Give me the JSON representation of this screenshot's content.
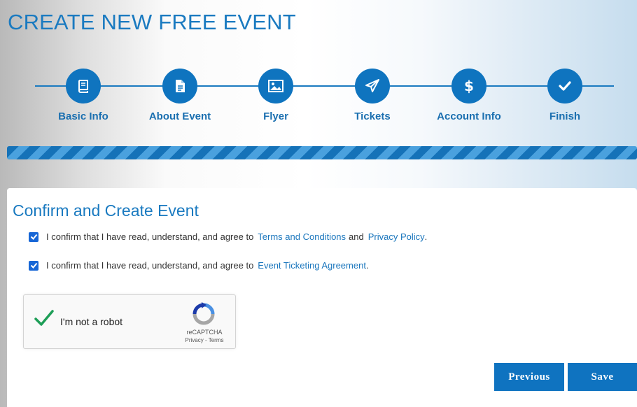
{
  "page": {
    "title": "CREATE NEW FREE EVENT"
  },
  "steps": [
    {
      "label": "Basic Info",
      "icon": "book-icon"
    },
    {
      "label": "About Event",
      "icon": "document-icon"
    },
    {
      "label": "Flyer",
      "icon": "image-icon"
    },
    {
      "label": "Tickets",
      "icon": "paper-plane-icon"
    },
    {
      "label": "Account Info",
      "icon": "dollar-icon"
    },
    {
      "label": "Finish",
      "icon": "checkmark-icon"
    }
  ],
  "progress": {
    "percent": 100
  },
  "form": {
    "title": "Confirm and Create Event",
    "agree1": {
      "text": "I confirm that I have read, understand, and agree to",
      "link1": "Terms and Conditions",
      "and": "and",
      "link2": "Privacy Policy",
      "end": ".",
      "checked": true
    },
    "agree2": {
      "text": "I confirm that I have read, understand, and agree to",
      "link": "Event Ticketing Agreement",
      "end": ".",
      "checked": true
    },
    "recaptcha": {
      "label": "I'm not a robot",
      "brand": "reCAPTCHA",
      "privacy": "Privacy",
      "separator": " - ",
      "terms": "Terms",
      "checked": true
    },
    "buttons": {
      "previous": "Previous",
      "save": "Save"
    }
  },
  "colors": {
    "primary": "#0f74bf",
    "title": "#1a7ac0",
    "checkbox": "#1766d6",
    "recaptcha_check": "#1e9e57"
  }
}
